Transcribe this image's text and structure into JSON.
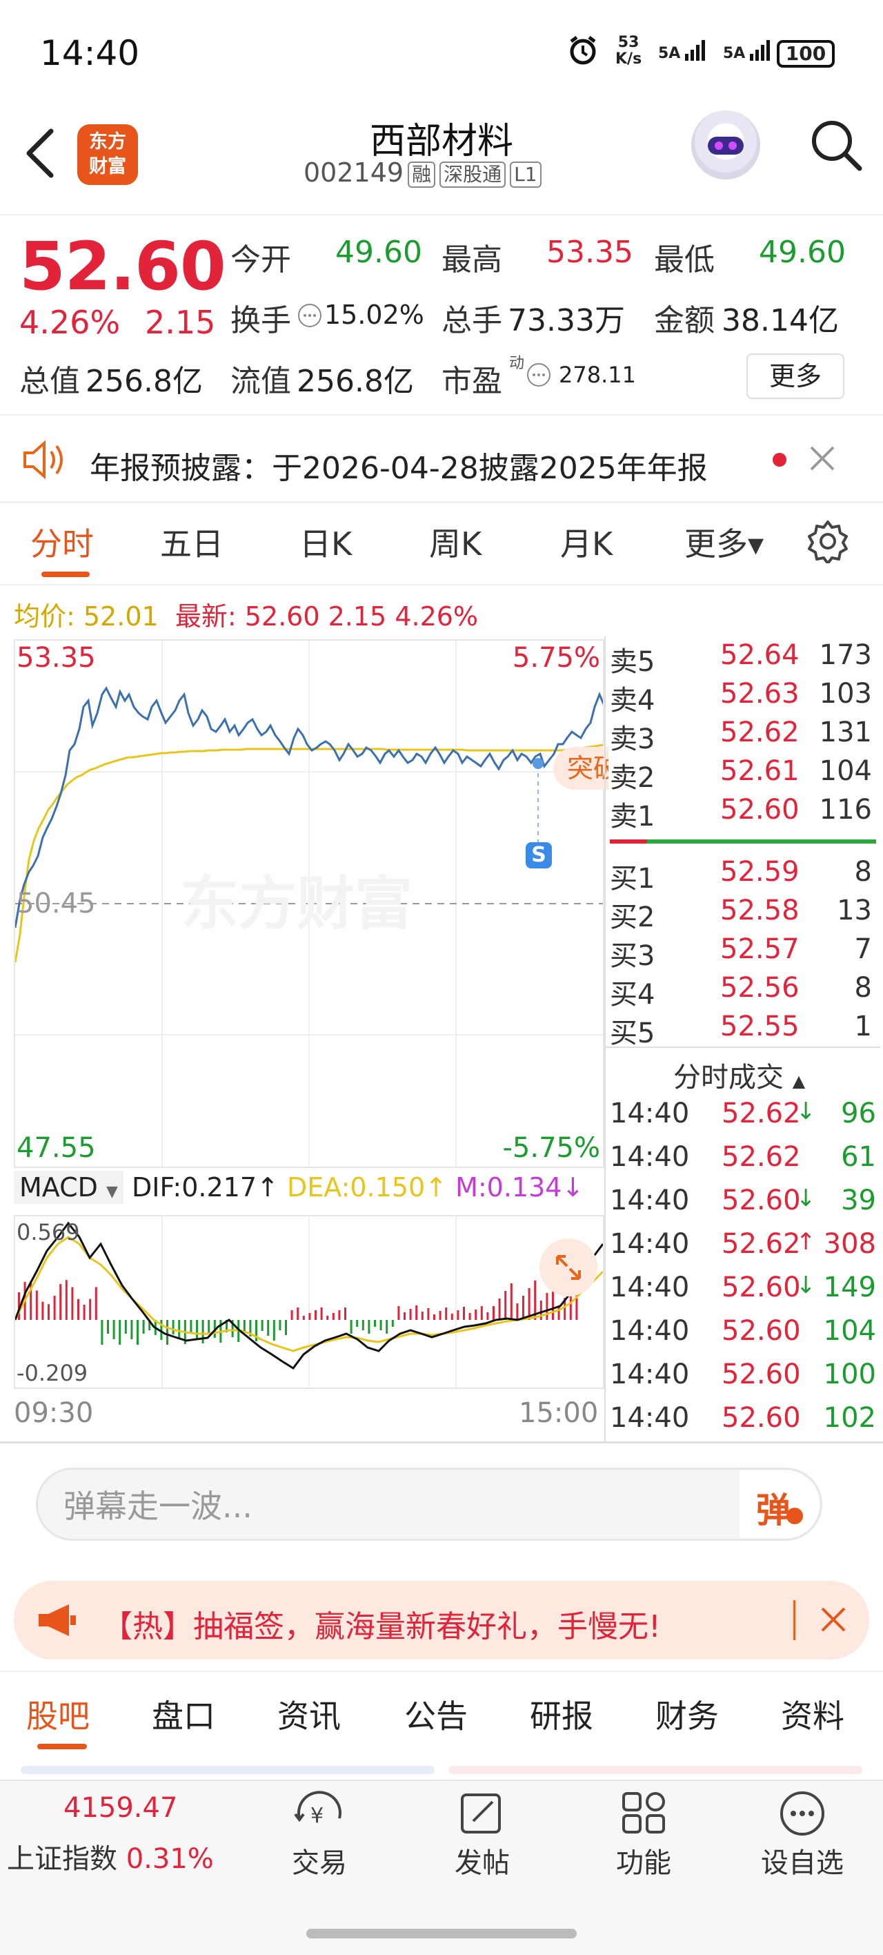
{
  "status_bar": {
    "time": "14:40",
    "net_speed_top": "53",
    "net_speed_bottom": "K/s",
    "signal1": "5A",
    "signal2": "5A",
    "battery": "100"
  },
  "header": {
    "app_logo_line1": "东方",
    "app_logo_line2": "财富",
    "stock_name": "西部材料",
    "stock_code": "002149",
    "tags": [
      "融",
      "深股通",
      "L1"
    ]
  },
  "quote": {
    "price": "52.60",
    "change_pct": "4.26%",
    "change_amt": "2.15",
    "open_label": "今开",
    "open": "49.60",
    "high_label": "最高",
    "high": "53.35",
    "low_label": "最低",
    "low": "49.60",
    "turnover_label": "换手",
    "turnover": "15.02%",
    "volume_label": "总手",
    "volume": "73.33万",
    "amount_label": "金额",
    "amount": "38.14亿",
    "mktcap_label": "总值",
    "mktcap": "256.8亿",
    "float_label": "流值",
    "float_cap": "256.8亿",
    "pe_label": "市盈",
    "pe_sup": "动",
    "pe": "278.11",
    "more_label": "更多"
  },
  "notice": {
    "text": "年报预披露：于2026-04-28披露2025年年报"
  },
  "chart_tabs": [
    "分时",
    "五日",
    "日K",
    "周K",
    "月K",
    "更多▾"
  ],
  "chart_header": {
    "avg_label": "均价: 52.01",
    "latest_label": "最新: 52.60",
    "latest_chg": "2.15",
    "latest_pct": "4.26%"
  },
  "intraday": {
    "y_top": "53.35",
    "y_mid": "50.45",
    "y_bottom": "47.55",
    "pct_top": "5.75%",
    "pct_bottom": "-5.75%",
    "tooltip_partial": "突破",
    "s_marker": "S",
    "watermark": "东方财富",
    "time_start": "09:30",
    "time_end": "15:00"
  },
  "macd": {
    "label": "MACD",
    "dif": "DIF:0.217",
    "dea": "DEA:0.150",
    "m": "M:0.134",
    "y_top": "0.569",
    "y_bottom": "-0.209"
  },
  "order_book": {
    "asks": [
      {
        "label": "卖5",
        "price": "52.64",
        "vol": "173"
      },
      {
        "label": "卖4",
        "price": "52.63",
        "vol": "103"
      },
      {
        "label": "卖3",
        "price": "52.62",
        "vol": "131"
      },
      {
        "label": "卖2",
        "price": "52.61",
        "vol": "104"
      },
      {
        "label": "卖1",
        "price": "52.60",
        "vol": "116"
      }
    ],
    "bids": [
      {
        "label": "买1",
        "price": "52.59",
        "vol": "8"
      },
      {
        "label": "买2",
        "price": "52.58",
        "vol": "13"
      },
      {
        "label": "买3",
        "price": "52.57",
        "vol": "7"
      },
      {
        "label": "买4",
        "price": "52.56",
        "vol": "8"
      },
      {
        "label": "买5",
        "price": "52.55",
        "vol": "1"
      }
    ]
  },
  "trades": {
    "title": "分时成交",
    "rows": [
      {
        "time": "14:40",
        "price": "52.62",
        "dir": "↓",
        "vol": "96",
        "dir_color": "green",
        "vol_color": "green"
      },
      {
        "time": "14:40",
        "price": "52.62",
        "dir": "",
        "vol": "61",
        "dir_color": "",
        "vol_color": "green"
      },
      {
        "time": "14:40",
        "price": "52.60",
        "dir": "↓",
        "vol": "39",
        "dir_color": "green",
        "vol_color": "green"
      },
      {
        "time": "14:40",
        "price": "52.62",
        "dir": "↑",
        "vol": "308",
        "dir_color": "red",
        "vol_color": "red"
      },
      {
        "time": "14:40",
        "price": "52.60",
        "dir": "↓",
        "vol": "149",
        "dir_color": "green",
        "vol_color": "green"
      },
      {
        "time": "14:40",
        "price": "52.60",
        "dir": "",
        "vol": "104",
        "dir_color": "",
        "vol_color": "green"
      },
      {
        "time": "14:40",
        "price": "52.60",
        "dir": "",
        "vol": "100",
        "dir_color": "",
        "vol_color": "green"
      },
      {
        "time": "14:40",
        "price": "52.60",
        "dir": "",
        "vol": "102",
        "dir_color": "",
        "vol_color": "green"
      }
    ]
  },
  "danmu": {
    "placeholder": "弹幕走一波...",
    "button": "弹"
  },
  "promo": {
    "text": "【热】抽福签，赢海量新春好礼，手慢无!"
  },
  "bottom_tabs": [
    "股吧",
    "盘口",
    "资讯",
    "公告",
    "研报",
    "财务",
    "资料"
  ],
  "bottom_nav": {
    "index_value": "4159.47",
    "index_name": "上证指数",
    "index_pct": "0.31%",
    "items": [
      "交易",
      "发帖",
      "功能",
      "设自选"
    ]
  },
  "colors": {
    "up": "#e2233a",
    "down": "#1a9c2f",
    "accent": "#e8551a",
    "price_line": "#3a6fb0",
    "avg_line": "#e8c51a"
  }
}
